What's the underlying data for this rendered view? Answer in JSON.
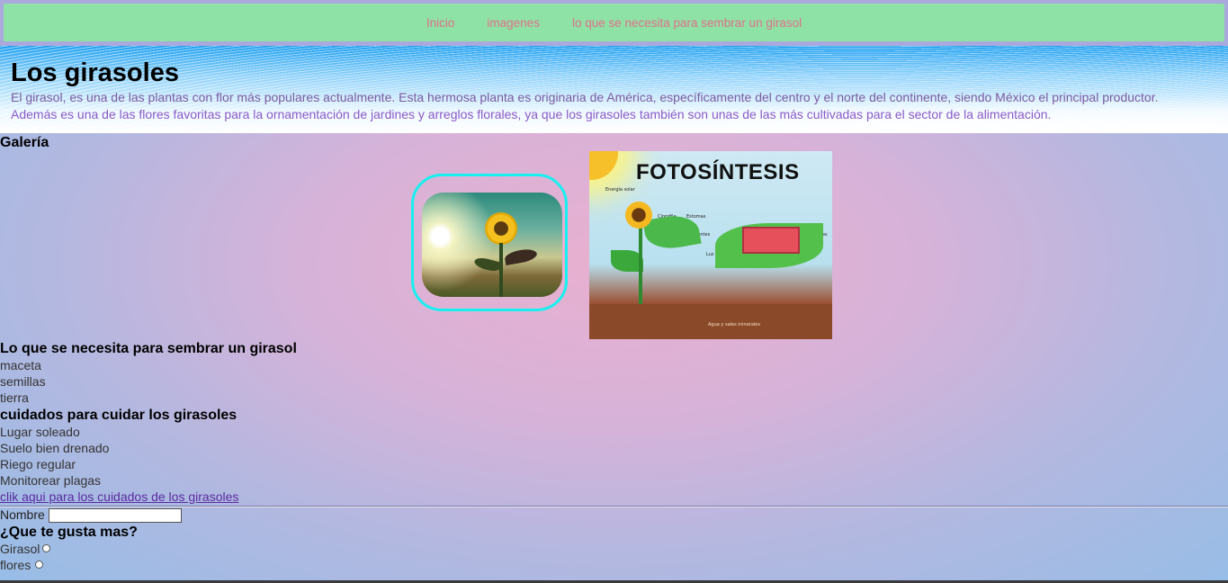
{
  "nav": {
    "items": [
      "Inicio",
      "imagenes",
      "lo que se necesita para sembrar un girasol"
    ]
  },
  "header": {
    "title": "Los girasoles",
    "paragraph1": "El girasol, es una de las plantas con flor más populares actualmente. Esta hermosa planta es originaria de América, específicamente del centro y el norte del continente, siendo México el principal productor.",
    "paragraph2": "Además es una de las flores favoritas para la ornamentación de jardines y arreglos florales, ya que los girasoles también son unas de las más cultivadas para el sector de la alimentación."
  },
  "gallery": {
    "title": "Galería",
    "diagram_title": "FOTOSÍNTESIS",
    "diagram_labels": [
      "Energía solar",
      "Clorofila",
      "Estomas",
      "Nutrientes",
      "Luz solar incidente",
      "Azúcares",
      "Agua y sales minerales"
    ]
  },
  "needs": {
    "title": "Lo que se necesita para sembrar un girasol",
    "items": [
      "maceta",
      "semillas",
      "tierra"
    ]
  },
  "care": {
    "title": "cuidados para cuidar los girasoles",
    "items": [
      "Lugar soleado",
      "Suelo bien drenado",
      "Riego regular",
      "Monitorear plagas"
    ],
    "link": "clik aqui para los cuidados de los girasoles"
  },
  "form": {
    "name_label": "Nombre",
    "name_value": "",
    "question": "¿Que te gusta mas?",
    "options": [
      "Girasol",
      "flores"
    ]
  },
  "colors": {
    "nav_bg": "#8fe2a6",
    "nav_link": "#e0708a",
    "frame": "#18f0f0",
    "link": "#5a2aa0"
  }
}
